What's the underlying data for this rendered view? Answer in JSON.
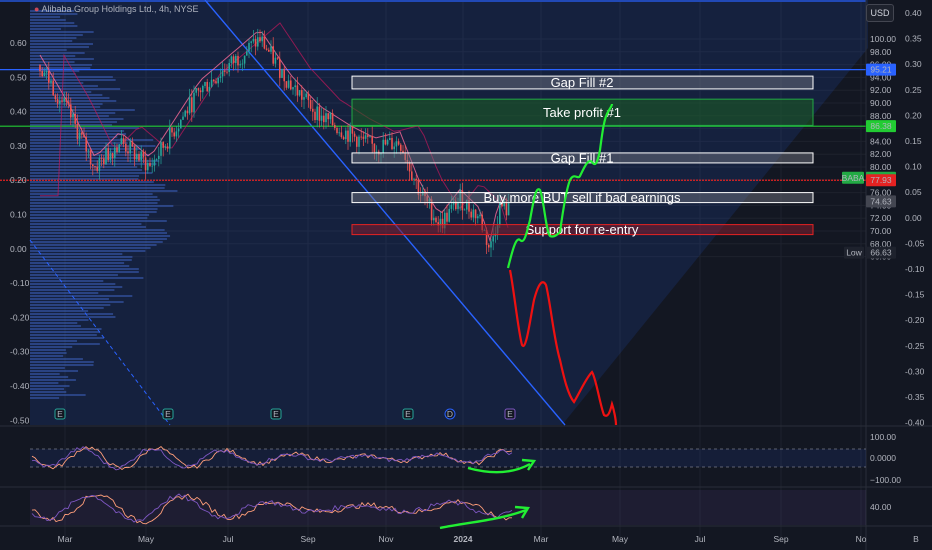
{
  "header": {
    "symbol_title": "Alibaba Group Holdings Ltd., 4h, NYSE",
    "currency_button": "USD"
  },
  "colors": {
    "background": "#131722",
    "candle_up": "#26a69a",
    "candle_down": "#ef5350",
    "trendline": "#2962ff",
    "green_line": "#22cc33",
    "red_line": "#e52222",
    "top_line": "#2962ff",
    "white_zone": "#ffffff"
  },
  "chart_data": [
    {
      "type": "line",
      "title": "Alibaba Group Holdings Ltd., 4h, NYSE",
      "xlabel": "",
      "ylabel": "",
      "x_ticks": [
        "Mar",
        "May",
        "Jul",
        "Sep",
        "Nov",
        "2024",
        "Mar",
        "May",
        "Jul",
        "Sep",
        "No",
        "B"
      ],
      "price_axis_ticks": [
        100.0,
        98.0,
        96.0,
        94.0,
        92.0,
        90.0,
        88.0,
        86.0,
        84.0,
        82.0,
        80.0,
        78.0,
        76.0,
        74.0,
        72.0,
        70.0,
        68.0,
        66.0
      ],
      "left_axis_ticks": [
        0.6,
        0.5,
        0.4,
        0.3,
        0.2,
        0.1,
        0.0,
        -0.1,
        -0.2,
        -0.3,
        -0.4,
        -0.5
      ],
      "right_axis_ticks": [
        0.4,
        0.35,
        0.3,
        0.25,
        0.2,
        0.15,
        0.1,
        0.05,
        0.0,
        -0.05,
        -0.1,
        -0.15,
        -0.2,
        -0.25,
        -0.3,
        -0.35,
        -0.4
      ],
      "ylim": [
        65.5,
        101.5
      ],
      "price_labels": [
        {
          "text": "95.21",
          "value": 95.21,
          "color": "#2962ff"
        },
        {
          "text": "86.38",
          "value": 86.38,
          "color": "#22cc33"
        },
        {
          "text": "78.32",
          "value": 78.32,
          "color": "#22aa44",
          "prefix": "BABA"
        },
        {
          "text": "77.93",
          "value": 77.93,
          "color": "#e52222"
        },
        {
          "text": "74.63",
          "value": 74.63,
          "color": "#434651"
        },
        {
          "text": "66.63",
          "value": 66.63,
          "color": "#1e222d",
          "prefix": "Low"
        }
      ],
      "horizontal_lines": [
        {
          "name": "blue-level",
          "value": 95.21,
          "color": "#2962ff"
        },
        {
          "name": "green-level",
          "value": 86.38,
          "color": "#22cc33"
        },
        {
          "name": "red-level",
          "value": 77.93,
          "color": "#e52222"
        }
      ],
      "zones": [
        {
          "label": "Gap Fill #2",
          "top": 94.2,
          "bottom": 92.2,
          "color": "#ffffff"
        },
        {
          "label": "Take profit #1",
          "top": 90.6,
          "bottom": 86.5,
          "color": "#22aa44"
        },
        {
          "label": "Gap Fill #1",
          "top": 82.2,
          "bottom": 81.1,
          "color": "#ffffff"
        },
        {
          "label": "Buy more BUT sell if bad earnings",
          "top": 76.0,
          "bottom": 75.0,
          "color": "#ffffff"
        },
        {
          "label": "Support for re-entry",
          "top": 71.0,
          "bottom": 69.5,
          "color": "#e52222"
        }
      ],
      "events": [
        "E",
        "E",
        "E",
        "E",
        "D",
        "E"
      ]
    },
    {
      "type": "line",
      "title": "",
      "y_ticks": [
        "100.00",
        "0.0000",
        "−100.00"
      ],
      "ylim": [
        -120,
        120
      ]
    },
    {
      "type": "line",
      "title": "",
      "y_ticks": [
        "40.00"
      ],
      "ylim": [
        15,
        75
      ]
    }
  ]
}
